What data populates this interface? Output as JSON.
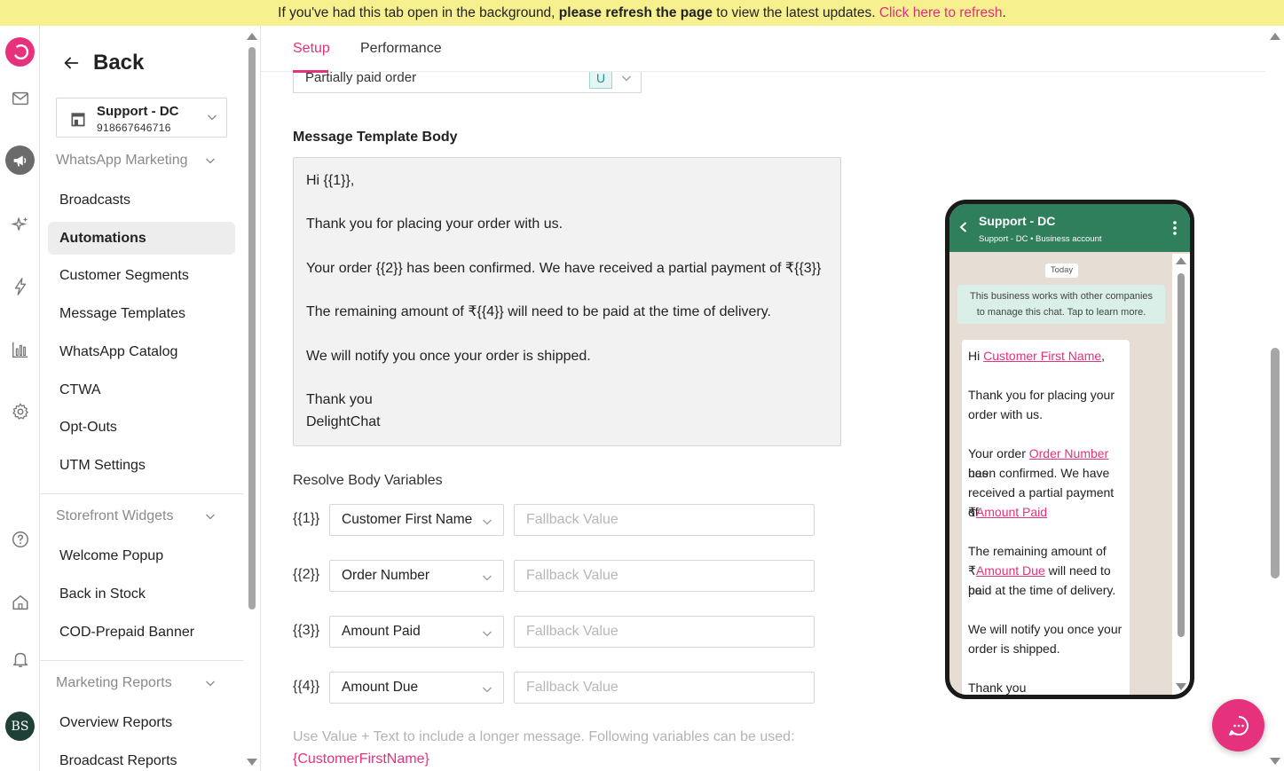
{
  "banner": {
    "text_pre": "If you've had this tab open in the background, ",
    "text_bold": "please refresh the page",
    "text_mid": " to view the latest updates. ",
    "link": "Click here to refresh",
    "text_end": "."
  },
  "rail": {
    "icons": [
      "delightchat-logo-icon",
      "mail-icon",
      "megaphone-icon",
      "sparkle-icon",
      "lightning-icon",
      "bar-chart-icon",
      "gear-icon",
      "help-icon",
      "home-icon",
      "bell-icon",
      "user-avatar"
    ],
    "avatar_initials": "BS"
  },
  "sidebar": {
    "back_label": "Back",
    "account": {
      "name": "Support - DC",
      "number": "918667646716"
    },
    "sections": [
      {
        "label": "WhatsApp Marketing",
        "items": [
          "Broadcasts",
          "Automations",
          "Customer Segments",
          "Message Templates",
          "WhatsApp Catalog",
          "CTWA",
          "Opt-Outs",
          "UTM Settings"
        ]
      },
      {
        "label": "Storefront Widgets",
        "items": [
          "Welcome Popup",
          "Back in Stock",
          "COD-Prepaid Banner"
        ]
      },
      {
        "label": "Marketing Reports",
        "items": [
          "Overview Reports",
          "Broadcast Reports"
        ]
      }
    ],
    "active_item": "Automations"
  },
  "tabs": {
    "setup": "Setup",
    "performance": "Performance"
  },
  "template_select": {
    "value": "Partially paid order",
    "badge": "U"
  },
  "body": {
    "heading": "Message Template Body",
    "lines": [
      "Hi {{1}},",
      "",
      "Thank you for placing your order with us.",
      "",
      "Your order {{2}} has been confirmed. We have received a partial payment of ₹{{3}}",
      "",
      "The remaining amount of ₹{{4}} will need to be paid at the time of delivery.",
      "",
      "We will notify you once your order is shipped.",
      "",
      "Thank you",
      "DelightChat"
    ]
  },
  "resolve": {
    "heading": "Resolve Body Variables",
    "fallback_placeholder": "Fallback Value",
    "rows": [
      {
        "var": "{{1}}",
        "value": "Customer First Name"
      },
      {
        "var": "{{2}}",
        "value": "Order Number"
      },
      {
        "var": "{{3}}",
        "value": "Amount Paid"
      },
      {
        "var": "{{4}}",
        "value": "Amount Due"
      }
    ],
    "hint": "Use Value + Text to include a longer message. Following variables can be used:",
    "hint_var": "{CustomerFirstName}"
  },
  "preview": {
    "name": "Support - DC",
    "subtitle": "Support - DC • Business account",
    "today": "Today",
    "biz_note_1": "This business works with other companies",
    "biz_note_2": "to manage this chat. Tap to learn more.",
    "msg": {
      "hi": "Hi ",
      "v1": "Customer First Name",
      "comma": ",",
      "thanks_1": "Thank you for placing your",
      "thanks_2": "order with us.",
      "order_pre": "Your order ",
      "v2": "Order Number",
      "order_post": " has",
      "confirm_1": "been confirmed. We have",
      "confirm_2": "received a partial payment of",
      "rupee": "₹",
      "v3": "Amount Paid",
      "remain_1": "The remaining amount of",
      "v4": "Amount Due",
      "remain_post": " will need to be",
      "remain_3": "paid at the time of delivery.",
      "notify_1": "We will notify you once your",
      "notify_2": "order is shipped.",
      "thank_you": "Thank you"
    }
  },
  "colors": {
    "brand": "#e6317d",
    "whatsapp_header": "#2f7e5c",
    "banner": "#f7f08f"
  }
}
